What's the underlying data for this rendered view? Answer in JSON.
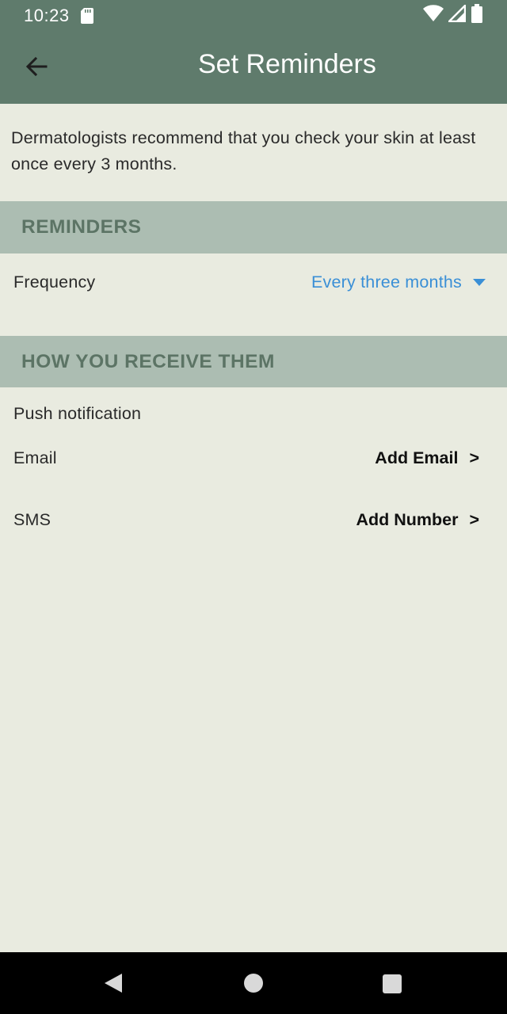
{
  "status_bar": {
    "time": "10:23"
  },
  "app_bar": {
    "title": "Set Reminders"
  },
  "intro_text": "Dermatologists recommend that you check your skin at least once every 3 months.",
  "reminders_section": {
    "header": "REMINDERS",
    "frequency_label": "Frequency",
    "frequency_value": "Every three months"
  },
  "receive_section": {
    "header": "HOW YOU RECEIVE THEM",
    "push_label": "Push notification",
    "email_label": "Email",
    "email_action": "Add Email",
    "sms_label": "SMS",
    "sms_action": "Add Number",
    "chevron": ">"
  },
  "colors": {
    "app_bar": "#5f7b6c",
    "section_header_bg": "#acbdb2",
    "section_header_text": "#5c7465",
    "background": "#e9ebe0",
    "dropdown_accent": "#3a8fd6"
  },
  "icons": {
    "back": "arrow-left-icon",
    "sd_card": "sd-card-icon",
    "wifi": "wifi-icon",
    "signal": "signal-icon",
    "battery": "battery-icon"
  }
}
